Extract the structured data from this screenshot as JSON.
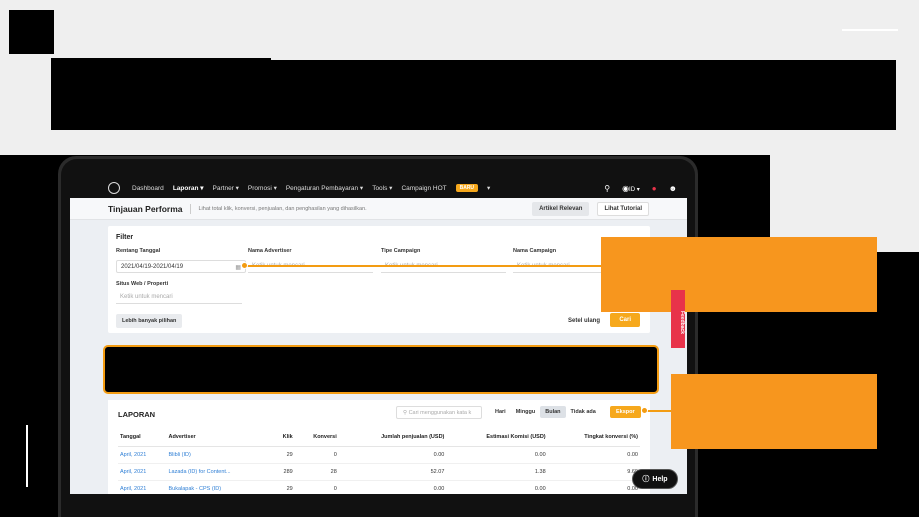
{
  "nav": {
    "items": [
      "Dashboard",
      "Laporan ▾",
      "Partner ▾",
      "Promosi ▾",
      "Pengaturan Pembayaran ▾",
      "Tools ▾",
      "Campaign HOT"
    ],
    "badge": "BARU",
    "badge_caret": "▾",
    "lang": "ID ▾"
  },
  "subheader": {
    "title": "Tinjauan Performa",
    "description": "Lihat total klik, konversi, penjualan, dan penghasilan yang dihasilkan.",
    "relevant_articles": "Artikel Relevan",
    "tutorial": "Lihat Tutorial"
  },
  "filter": {
    "title": "Filter",
    "date_label": "Rentang Tanggal",
    "date_value": "2021/04/19-2021/04/19",
    "advertiser_label": "Nama Advertiser",
    "campaign_type_label": "Tipe Campaign",
    "campaign_name_label": "Nama Campaign",
    "placeholder": "Ketik untuk mencari",
    "site_label": "Situs Web / Properti",
    "more_options": "Lebih banyak pilihan",
    "reset": "Setel ulang",
    "search": "Cari"
  },
  "report": {
    "title": "LAPORAN",
    "search_placeholder": "Cari menggunakan kata k",
    "periods": [
      "Hari",
      "Minggu",
      "Bulan",
      "Tidak ada"
    ],
    "selected_period": "Bulan",
    "export": "Ekspor",
    "columns": [
      "Tanggal",
      "Advertiser",
      "Klik",
      "Konversi",
      "Jumlah penjualan (USD)",
      "Estimasi Komisi (USD)",
      "Tingkat konversi (%)"
    ],
    "rows": [
      [
        "April, 2021",
        "Blibli (ID)",
        "29",
        "0",
        "0.00",
        "0.00",
        "0.00"
      ],
      [
        "April, 2021",
        "Lazada (ID) for Content...",
        "289",
        "28",
        "52.07",
        "1.38",
        "9.69"
      ],
      [
        "April, 2021",
        "Bukalapak - CPS (ID)",
        "29",
        "0",
        "0.00",
        "0.00",
        "0.00"
      ]
    ]
  },
  "feedback": "Feedback",
  "help": "Help",
  "colors": {
    "accent": "#f7961e",
    "link": "#2f7fd5",
    "dark": "#111111"
  }
}
